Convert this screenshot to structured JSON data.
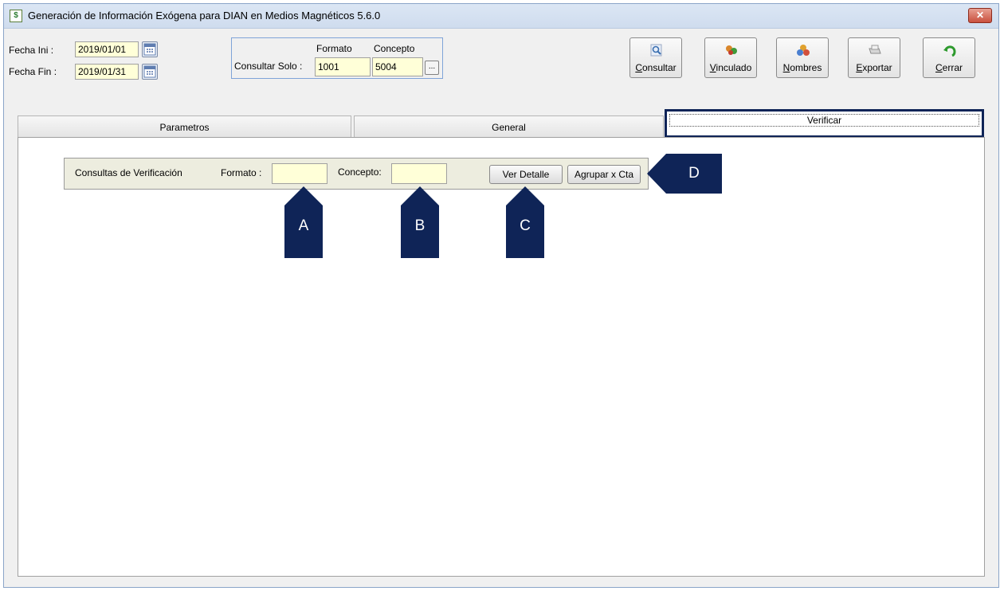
{
  "window": {
    "title": "Generación de Información Exógena para DIAN en Medios Magnéticos 5.6.0",
    "close_label": "✕"
  },
  "dates": {
    "fecha_ini_label": "Fecha Ini :",
    "fecha_ini_value": "2019/01/01",
    "fecha_fin_label": "Fecha Fin :",
    "fecha_fin_value": "2019/01/31"
  },
  "consultar_solo": {
    "label": "Consultar Solo :",
    "formato_header": "Formato",
    "concepto_header": "Concepto",
    "formato_value": "1001",
    "concepto_value": "5004",
    "ellipsis_label": "..."
  },
  "toolbar": {
    "buttons": [
      {
        "label": "Consultar",
        "icon": "search-icon"
      },
      {
        "label": "Vinculado",
        "icon": "link-people-icon"
      },
      {
        "label": "Nombres",
        "icon": "names-icon"
      },
      {
        "label": "Exportar",
        "icon": "export-icon"
      },
      {
        "label": "Cerrar",
        "icon": "undo-arrow-icon"
      }
    ]
  },
  "tabs": {
    "parametros": "Parametros",
    "general": "General",
    "verificar": "Verificar"
  },
  "verification": {
    "label": "Consultas de Verificación",
    "formato_label": "Formato :",
    "formato_value": "",
    "concepto_label": "Concepto:",
    "concepto_value": "",
    "ver_detalle": "Ver Detalle",
    "agrupar": "Agrupar x Cta"
  },
  "callouts": {
    "a": "A",
    "b": "B",
    "c": "C",
    "d": "D"
  },
  "colors": {
    "callout": "#0f2457",
    "input_bg": "#ffffd8"
  }
}
